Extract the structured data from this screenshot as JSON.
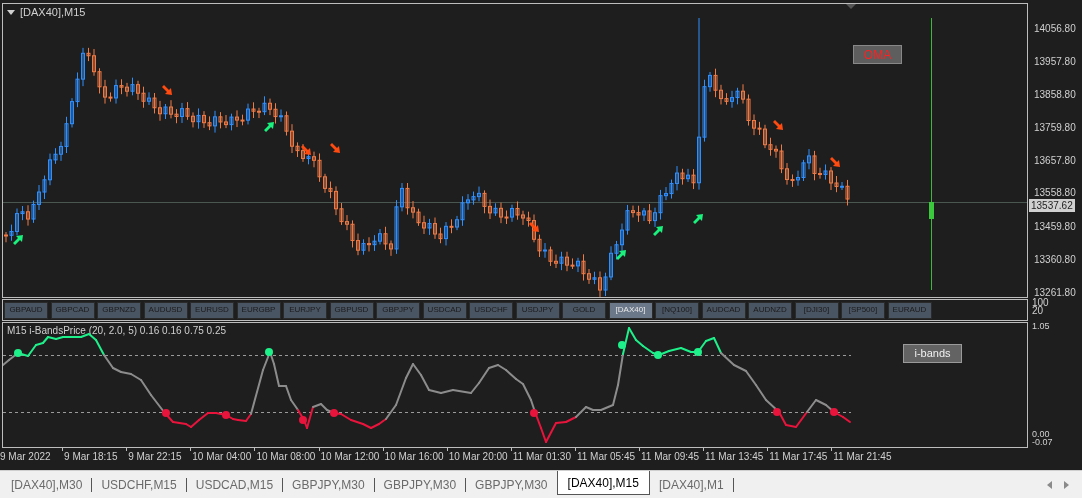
{
  "chart": {
    "title": "[DAX40],M15",
    "oma_button": "OMA",
    "current_price": "13537.62"
  },
  "price_axis": [
    "14056.80",
    "13957.80",
    "13858.80",
    "13759.80",
    "13657.80",
    "13558.80",
    "13459.80",
    "13360.80",
    "13261.80"
  ],
  "symbol_buttons": [
    {
      "label": "GBPAUD",
      "selected": false
    },
    {
      "label": "GBPCAD",
      "selected": false
    },
    {
      "label": "GBPNZD",
      "selected": false
    },
    {
      "label": "AUDUSD",
      "selected": false
    },
    {
      "label": "EURUSD",
      "selected": false
    },
    {
      "label": "EURGBP",
      "selected": false
    },
    {
      "label": "EURJPY",
      "selected": false
    },
    {
      "label": "GBPUSD",
      "selected": false
    },
    {
      "label": "GBPJPY",
      "selected": false
    },
    {
      "label": "USDCAD",
      "selected": false
    },
    {
      "label": "USDCHF",
      "selected": false
    },
    {
      "label": "USDJPY",
      "selected": false
    },
    {
      "label": "GOLD",
      "selected": false
    },
    {
      "label": "[DAX40]",
      "selected": true
    },
    {
      "label": "[NQ100]",
      "selected": false
    },
    {
      "label": "AUDCAD",
      "selected": false
    },
    {
      "label": "AUDNZD",
      "selected": false
    },
    {
      "label": "[DJI30]",
      "selected": false
    },
    {
      "label": "[SP500]",
      "selected": false
    },
    {
      "label": "EURAUD",
      "selected": false
    }
  ],
  "symbol_bar_axis": [
    "100",
    "20"
  ],
  "indicator": {
    "label": "M15 i-BandsPrice (20, 2.0, 5) 0.16 0.16 0.75 0.25",
    "button": "i-bands",
    "axis": [
      "1.05",
      "0.00",
      "-0.07"
    ]
  },
  "time_axis": [
    "9 Mar 2022",
    "9 Mar 18:15",
    "9 Mar 22:15",
    "10 Mar 04:00",
    "10 Mar 08:00",
    "10 Mar 12:00",
    "10 Mar 16:00",
    "10 Mar 20:00",
    "11 Mar 01:30",
    "11 Mar 05:45",
    "11 Mar 09:45",
    "11 Mar 13:45",
    "11 Mar 17:45",
    "11 Mar 21:45"
  ],
  "tabs": [
    {
      "label": "[DAX40],M30",
      "selected": false
    },
    {
      "label": "USDCHF,M15",
      "selected": false
    },
    {
      "label": "USDCAD,M15",
      "selected": false
    },
    {
      "label": "GBPJPY,M30",
      "selected": false
    },
    {
      "label": "GBPJPY,M30",
      "selected": false
    },
    {
      "label": "GBPJPY,M30",
      "selected": false
    },
    {
      "label": "[DAX40],M15",
      "selected": true
    },
    {
      "label": "[DAX40],M1",
      "selected": false
    }
  ]
}
